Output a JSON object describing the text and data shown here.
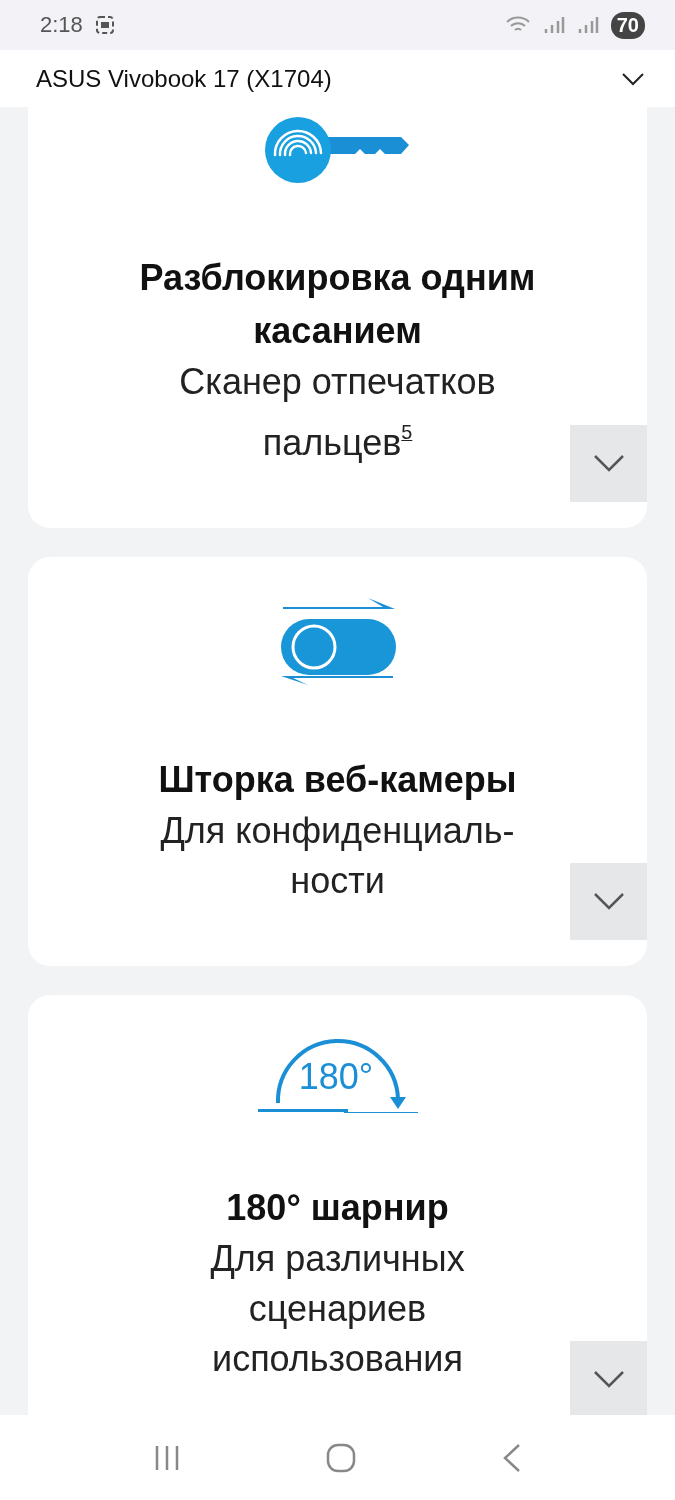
{
  "status_bar": {
    "time": "2:18",
    "battery": "70"
  },
  "header": {
    "title": "ASUS Vivobook 17 (X1704)",
    "expanded": false
  },
  "features": [
    {
      "kind": "fingerprint-key",
      "title": "Разблокировка одним касанием",
      "subtitle": "Сканер отпечатков пальцев$^{5}$",
      "expanded": false
    },
    {
      "kind": "shutter",
      "title": "Шторка веб-камеры",
      "subtitle": "Для конфиденциаль-ности",
      "expanded": false
    },
    {
      "kind": "hinge",
      "icon_text": "180°",
      "title": "180° шарнир",
      "subtitle": "Для различных сценариев использования",
      "expanded": false
    }
  ]
}
